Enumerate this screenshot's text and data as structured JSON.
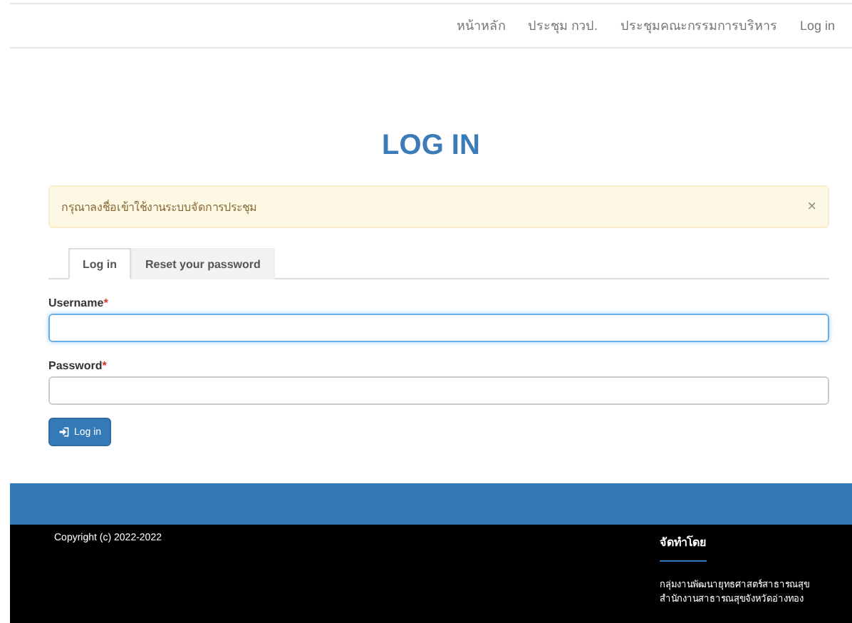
{
  "nav": {
    "items": [
      {
        "label": "หน้าหลัก"
      },
      {
        "label": "ประชุม กวป."
      },
      {
        "label": "ประชุมคณะกรรมการบริหาร"
      },
      {
        "label": "Log in"
      }
    ]
  },
  "title": "LOG IN",
  "alert": {
    "message": "กรุณาลงชื่อเข้าใช้งานระบบจัดการประชุม",
    "close": "×"
  },
  "tabs": [
    {
      "label": "Log in",
      "selected": true
    },
    {
      "label": "Reset your password",
      "selected": false
    }
  ],
  "fields": [
    {
      "label": "Username",
      "required_mark": "*",
      "focused": true
    },
    {
      "label": "Password",
      "required_mark": "*",
      "focused": false
    }
  ],
  "submit": {
    "label": "Log in"
  },
  "footer": {
    "copyright": "Copyright (c) 2022-2022",
    "heading": "จัดทำโดย",
    "lines": [
      "กลุ่มงานพัฒนายุทธศาสตร์สาธารณสุข",
      "สำนักงานสาธารณสุขจังหวัดอ่างทอง"
    ]
  }
}
